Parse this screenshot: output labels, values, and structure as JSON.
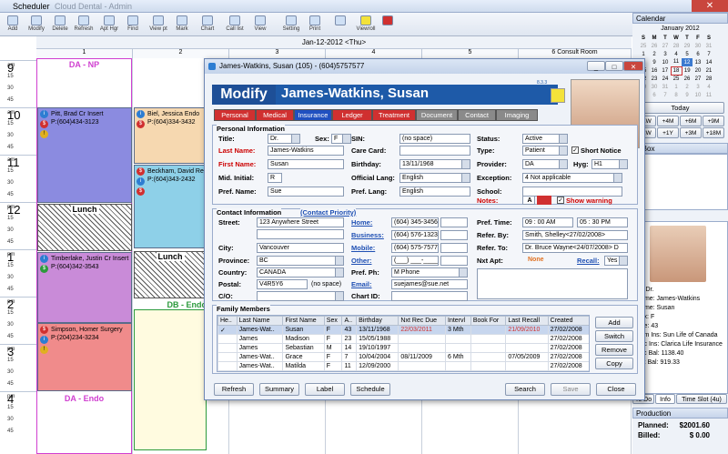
{
  "window": {
    "title": "Scheduler",
    "subtitle": "Cloud Dental - Admin"
  },
  "toolbar": {
    "items": [
      "Add",
      "Modify",
      "Delete",
      "Refresh",
      "Apt Hgr",
      "Find",
      "View pt",
      "Mark",
      "Chart",
      "Call list",
      "View",
      "Setting",
      "Print",
      "",
      "Viewroll",
      ""
    ]
  },
  "schedule": {
    "date": "Jan-12-2012 <Thu>",
    "columns": [
      "1",
      "2",
      "3",
      "4",
      "5",
      "6 Consult Room"
    ],
    "hours": [
      {
        "h": "9",
        "ap": "am"
      },
      {
        "h": "10",
        "ap": "am"
      },
      {
        "h": "11",
        "ap": "am"
      },
      {
        "h": "12",
        "ap": "pm"
      },
      {
        "h": "1",
        "ap": "pm"
      },
      {
        "h": "2",
        "ap": "pm"
      },
      {
        "h": "3",
        "ap": "pm"
      },
      {
        "h": "4",
        "ap": "pm"
      }
    ],
    "quarters": [
      "15",
      "30",
      "45"
    ],
    "col1_label": "DA - NP",
    "col1_label2": "DA - Endo",
    "col2_label": "DB - Endo",
    "lunch": "Lunch",
    "appts": [
      {
        "name": "Pitt, Brad Cr Insert",
        "phone": "P:(604)434-3123"
      },
      {
        "name": "Timberlake, Justin Cr Insert",
        "phone": "P:(604)342-3543"
      },
      {
        "name": "Simpson, Homer Surgery",
        "phone": "P:(204)234-3234"
      },
      {
        "name": "Biel, Jessica Endo",
        "phone": "P:(604)334-3432"
      },
      {
        "name": "Beckham, David Re",
        "phone": "P:(604)343-2432"
      }
    ],
    "badge_i": "i",
    "badge_s": "$",
    "badge_w": "!"
  },
  "calendar": {
    "title": "Calendar",
    "month": "January 2012",
    "dow": [
      "S",
      "M",
      "T",
      "W",
      "T",
      "F",
      "S"
    ],
    "weeks": [
      [
        "25",
        "26",
        "27",
        "28",
        "29",
        "30",
        "31"
      ],
      [
        "1",
        "2",
        "3",
        "4",
        "5",
        "6",
        "7"
      ],
      [
        "8",
        "9",
        "10",
        "11",
        "12",
        "13",
        "14"
      ],
      [
        "15",
        "16",
        "17",
        "18",
        "19",
        "20",
        "21"
      ],
      [
        "22",
        "23",
        "24",
        "25",
        "26",
        "27",
        "28"
      ],
      [
        "29",
        "30",
        "31",
        "1",
        "2",
        "3",
        "4"
      ],
      [
        "5",
        "6",
        "7",
        "8",
        "9",
        "10",
        "11"
      ]
    ],
    "today": "Today",
    "nav": [
      "+1W",
      "+4M",
      "+6M",
      "+9M",
      "+2W",
      "+1Y",
      "+3M",
      "+18M"
    ]
  },
  "clipbox": {
    "title": "p Box"
  },
  "preview": {
    "lines": [
      "Pt: Dr.",
      "Name: James-Watkins",
      "Name: Susan",
      "Sex: F",
      "Age: 43",
      "Prim Ins: Sun Life of Canada",
      "Sec Ins: Clarica Life Insurance",
      "Acc Bal: 1138.40",
      "Pat Bal: 919.33"
    ],
    "tabs": [
      "To Do",
      "Info",
      "Time Slot (4u)"
    ]
  },
  "production": {
    "title": "Production",
    "planned_label": "Planned:",
    "planned": "$2001.60",
    "billed_label": "Billed:",
    "billed": "$ 0.00"
  },
  "dialog": {
    "title": "James-Watkins, Susan (105) - (604)5757577",
    "mode": "Modify",
    "name": "James-Watkins, Susan",
    "version": "8.3.3",
    "tabs": [
      "Personal",
      "Medical",
      "Insurance",
      "Ledger",
      "Treatment",
      "Document",
      "Contact",
      "Imaging"
    ],
    "personal": {
      "section": "Personal Information",
      "title_l": "Title:",
      "title": "Dr.",
      "sex_l": "Sex:",
      "sex": "F",
      "last_l": "Last Name:",
      "last": "James-Watkins",
      "first_l": "First Name:",
      "first": "Susan",
      "mid_l": "Mid. Initial:",
      "mid": "R",
      "pref_l": "Pref. Name:",
      "pref": "Sue",
      "sin_l": "SIN:",
      "sin_hint": "(no space)",
      "care_l": "Care Card:",
      "bday_l": "Birthday:",
      "bday": "13/11/1968",
      "olang_l": "Official Lang:",
      "olang": "English",
      "plang_l": "Pref. Lang:",
      "plang": "English",
      "status_l": "Status:",
      "status": "Active",
      "type_l": "Type:",
      "type": "Patient",
      "short": "Short Notice",
      "prov_l": "Provider:",
      "prov": "DA",
      "hyg_l": "Hyg:",
      "hyg": "H1",
      "exc_l": "Exception:",
      "exc": "4 Not applicable",
      "school_l": "School:",
      "notes_l": "Notes:",
      "notes_a": "A",
      "warn": "Show warning"
    },
    "contact": {
      "section": "Contact Information",
      "priority": "(Contact Priority)",
      "street_l": "Street:",
      "street": "123 Anywhere Street",
      "city_l": "City:",
      "city": "Vancouver",
      "prov_l": "Province:",
      "prov": "BC",
      "country_l": "Country:",
      "country": "CANADA",
      "postal_l": "Postal:",
      "postal": "V4R5Y6",
      "postal_hint": "(no space)",
      "co_l": "C/O:",
      "home_l": "Home:",
      "home": "(604) 345-3456",
      "bus_l": "Business:",
      "bus": "(604) 576-1323",
      "mob_l": "Mobile:",
      "mob": "(604) 575-7577",
      "oth_l": "Other:",
      "oth": "(___) ___-____",
      "pph_l": "Pref. Ph:",
      "pph": "M Phone",
      "email_l": "Email:",
      "email": "suejames@sue.net",
      "chart_l": "Chart ID:",
      "ptime_l": "Pref. Time:",
      "t1": "09 : 00  AM",
      "t2": "05 : 30  PM",
      "refby_l": "Refer. By:",
      "refby": "Smith, Shelley<27/02/2008>",
      "refto_l": "Refer. To:",
      "refto": "Dr. Bruce Wayne<24/07/2008> D",
      "nxt_l": "Nxt Apt:",
      "nxt": "None",
      "recall_l": "Recall:",
      "recall": "Yes"
    },
    "family": {
      "section": "Family Members",
      "cols": [
        "He..",
        "Last Name",
        "First Name",
        "Sex",
        "A..",
        "Birthday",
        "Nxt Rec Due",
        "Intervl",
        "Book For",
        "Last Recall",
        "Created"
      ],
      "rows": [
        [
          "✓",
          "James-Wat..",
          "Susan",
          "F",
          "43",
          "13/11/1968",
          "22/03/2011",
          "3 Mth",
          "",
          "21/09/2010",
          "27/02/2008"
        ],
        [
          "",
          "James",
          "Madison",
          "F",
          "23",
          "15/05/1988",
          "",
          "",
          "",
          "",
          "27/02/2008"
        ],
        [
          "",
          "James",
          "Sebastian",
          "M",
          "14",
          "19/10/1997",
          "",
          "",
          "",
          "",
          "27/02/2008"
        ],
        [
          "",
          "James-Wat..",
          "Grace",
          "F",
          "7",
          "10/04/2004",
          "08/11/2009",
          "6 Mth",
          "",
          "07/05/2009",
          "27/02/2008"
        ],
        [
          "",
          "James-Wat..",
          "Matilda",
          "F",
          "11",
          "12/09/2000",
          "",
          "",
          "",
          "",
          "27/02/2008"
        ]
      ],
      "btns": [
        "Add",
        "Switch",
        "Remove",
        "Copy"
      ]
    },
    "footer": [
      "Refresh",
      "Summary",
      "Label",
      "Schedule",
      "Search",
      "Save",
      "Close"
    ]
  }
}
